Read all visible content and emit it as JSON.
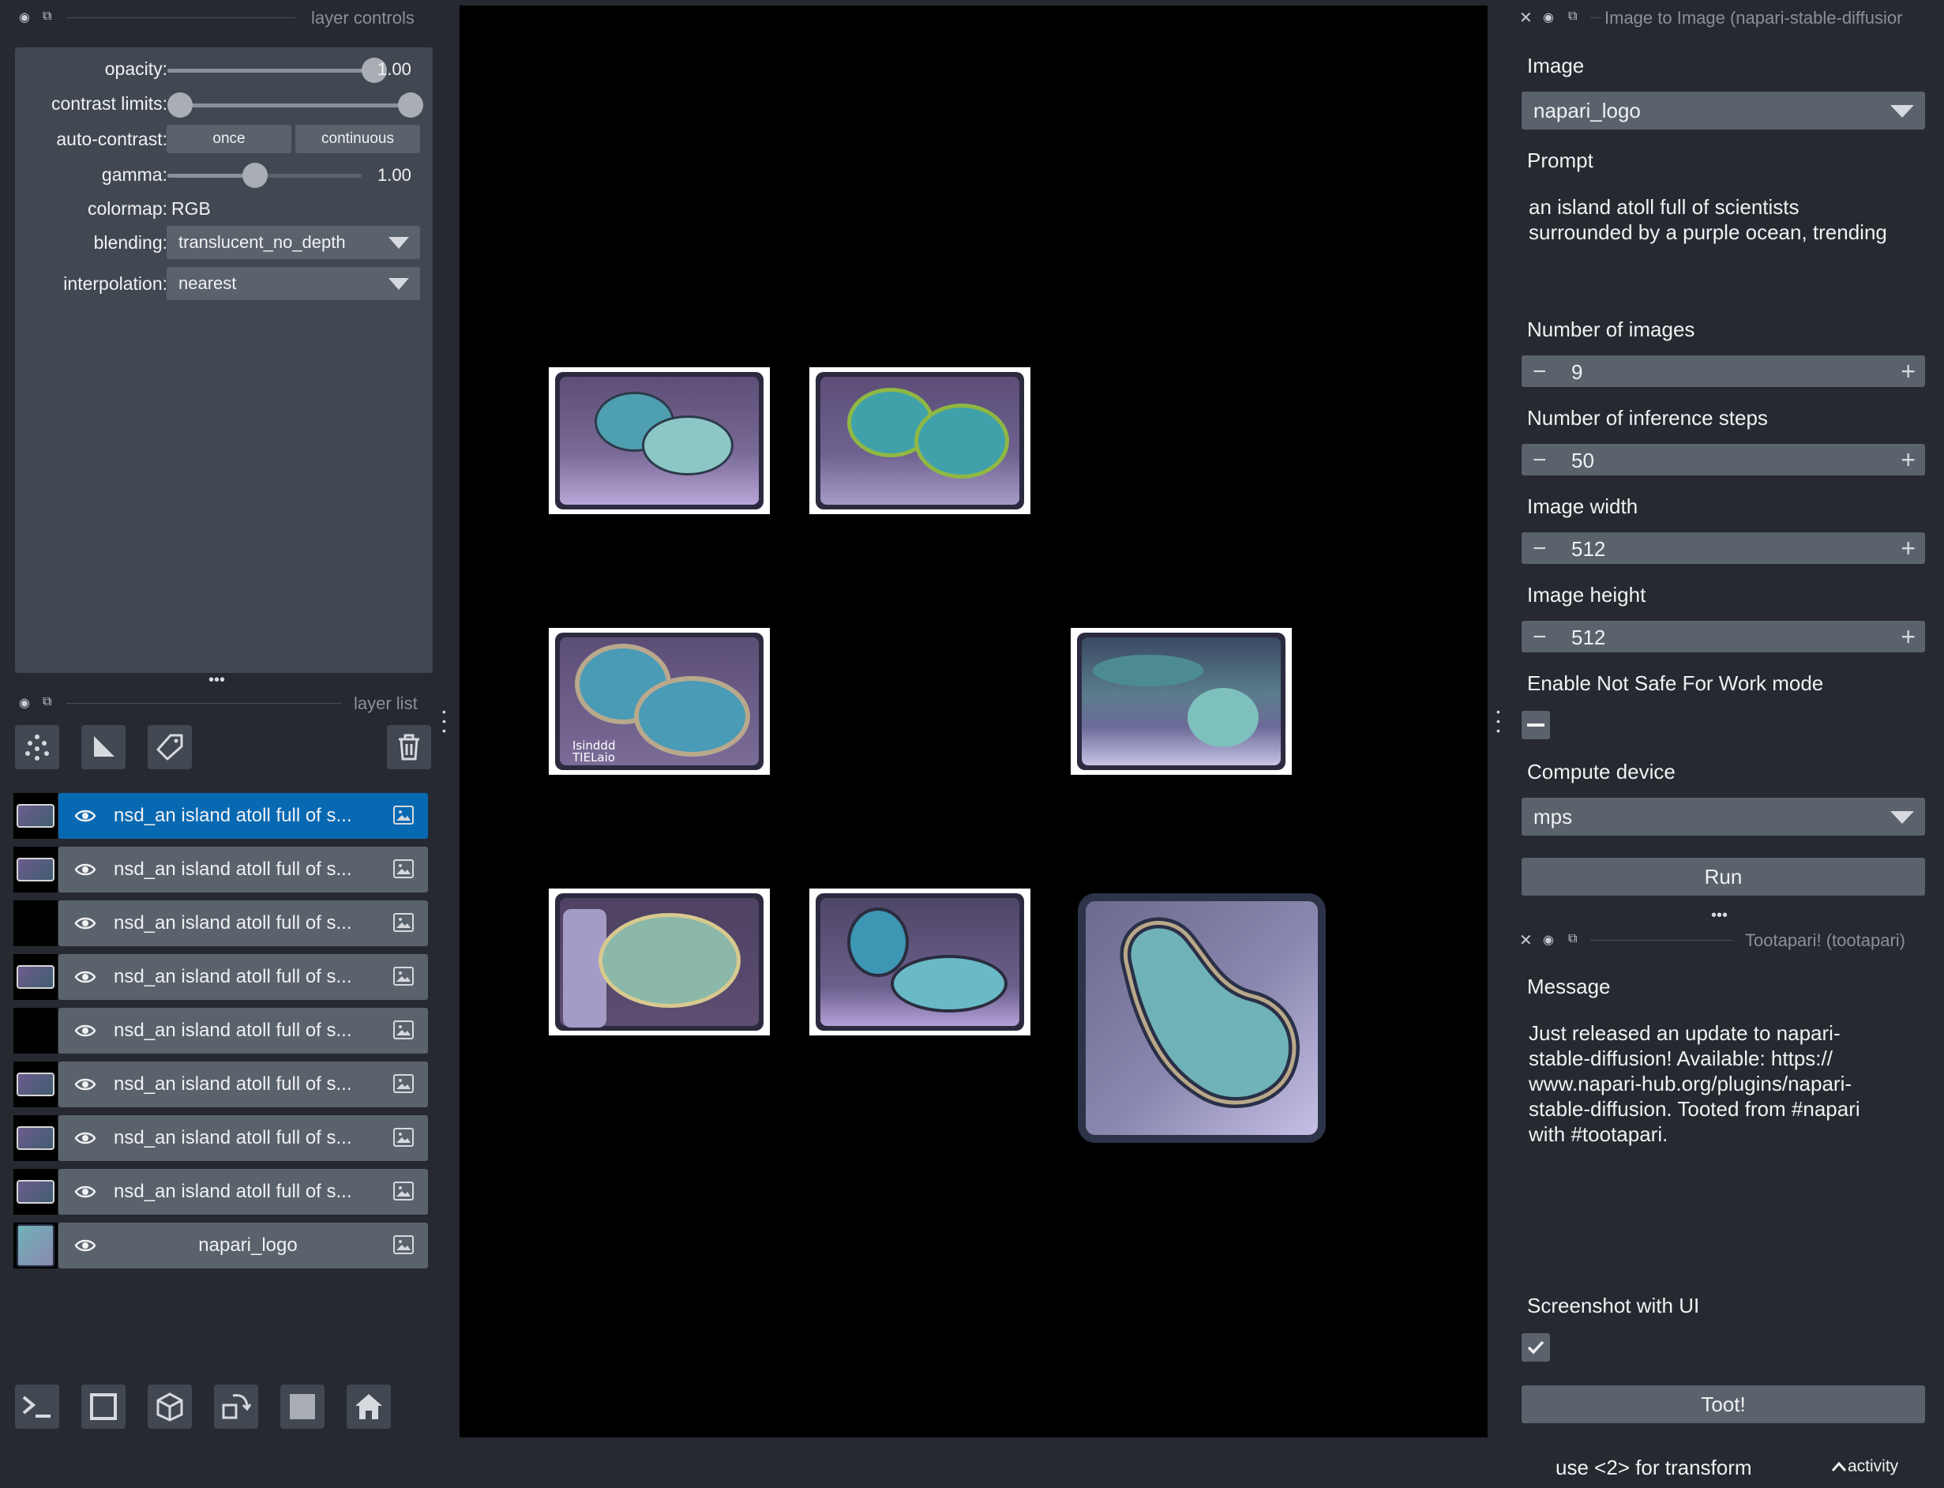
{
  "left_dock": {
    "controls_title": "layer controls",
    "list_title": "layer list",
    "handle": "•••"
  },
  "layer_controls": {
    "opacity_label": "opacity:",
    "opacity_value": "1.00",
    "opacity_level": 1.0,
    "contrast_label": "contrast limits:",
    "contrast_range": [
      0.0,
      1.0
    ],
    "autocontrast_label": "auto-contrast:",
    "once_label": "once",
    "continuous_label": "continuous",
    "gamma_label": "gamma:",
    "gamma_value": "1.00",
    "gamma_level": 0.45,
    "colormap_label": "colormap:",
    "colormap_value": "RGB",
    "blending_label": "blending:",
    "blending_value": "translucent_no_depth",
    "interpolation_label": "interpolation:",
    "interpolation_value": "nearest"
  },
  "layers": [
    {
      "name": "nsd_an island atoll full of s...",
      "selected": true
    },
    {
      "name": "nsd_an island atoll full of s...",
      "selected": false
    },
    {
      "name": "nsd_an island atoll full of s...",
      "selected": false
    },
    {
      "name": "nsd_an island atoll full of s...",
      "selected": false
    },
    {
      "name": "nsd_an island atoll full of s...",
      "selected": false
    },
    {
      "name": "nsd_an island atoll full of s...",
      "selected": false
    },
    {
      "name": "nsd_an island atoll full of s...",
      "selected": false
    },
    {
      "name": "nsd_an island atoll full of s...",
      "selected": false
    },
    {
      "name": "napari_logo",
      "selected": false
    }
  ],
  "img2img": {
    "title": "Image to Image (napari-stable-diffusior",
    "image_label": "Image",
    "image_value": "napari_logo",
    "prompt_label": "Prompt",
    "prompt_line1": "an island atoll full of scientists",
    "prompt_line2": "surrounded by a purple ocean, trending",
    "num_images_label": "Number of images",
    "num_images": "9",
    "steps_label": "Number of inference steps",
    "steps": "50",
    "width_label": "Image width",
    "width": "512",
    "height_label": "Image height",
    "height": "512",
    "nsfw_label": "Enable Not Safe For Work mode",
    "device_label": "Compute device",
    "device_value": "mps",
    "run_label": "Run"
  },
  "tootapari": {
    "title": "Tootapari! (tootapari)",
    "message_label": "Message",
    "message_lines": [
      "Just released an update to napari-",
      "stable-diffusion! Available: https://",
      "www.napari-hub.org/plugins/napari-",
      "stable-diffusion. Tooted from #napari",
      "with #tootapari."
    ],
    "screenshot_label": "Screenshot with UI",
    "screenshot_checked": true,
    "toot_label": "Toot!"
  },
  "status": {
    "hint": "use <2> for transform",
    "activity": "activity"
  },
  "canvas": {
    "tile_caption": "Isinddd TIELaio"
  },
  "colors": {
    "background": "#262930",
    "panel": "#414851",
    "widget": "#5a626c",
    "selection": "#0869b3",
    "canvas": "#000000"
  }
}
